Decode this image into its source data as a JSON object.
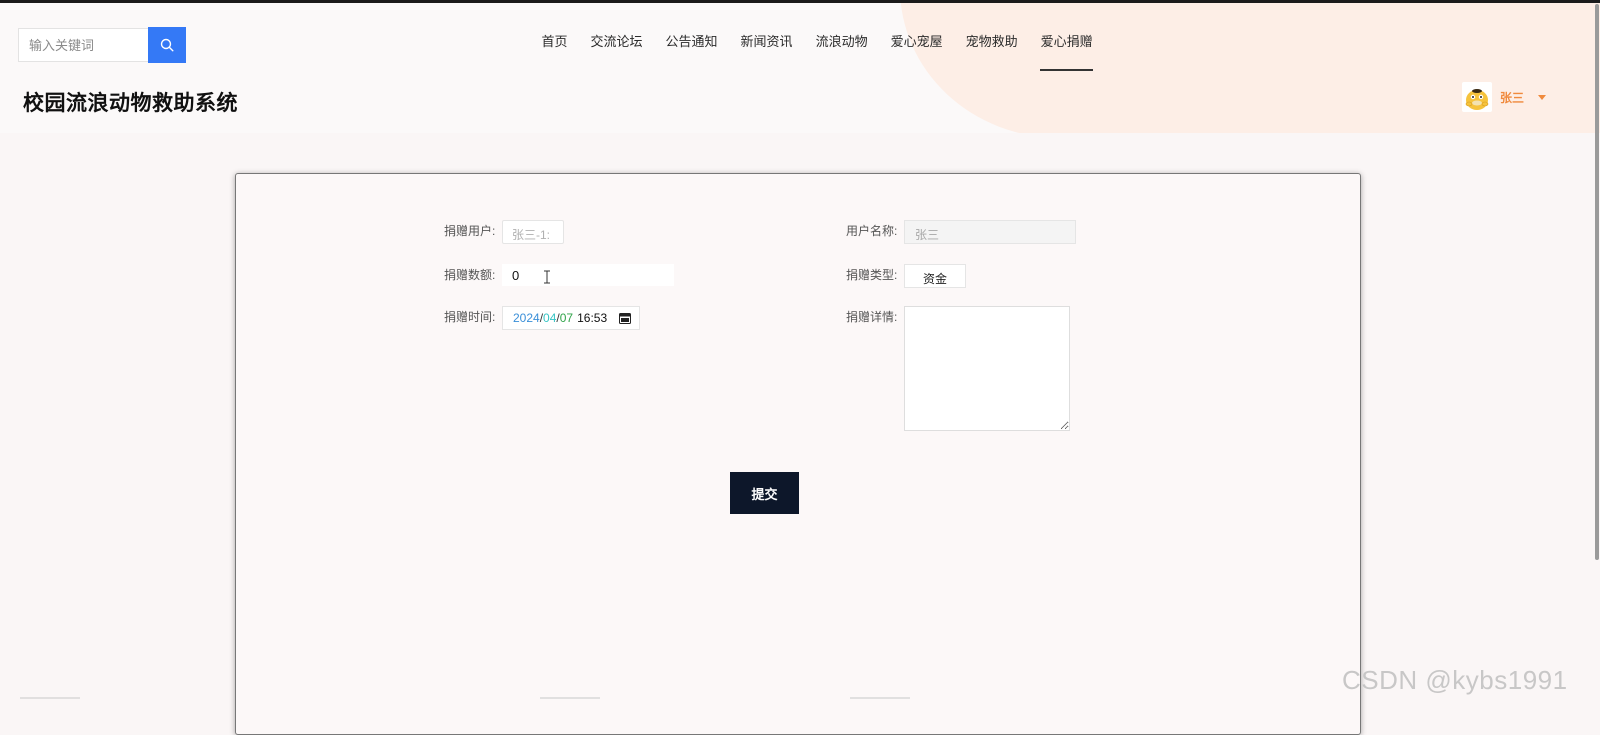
{
  "search": {
    "placeholder": "输入关键词",
    "icon": "search-icon"
  },
  "nav": {
    "items": [
      {
        "label": "首页",
        "active": false
      },
      {
        "label": "交流论坛",
        "active": false
      },
      {
        "label": "公告通知",
        "active": false
      },
      {
        "label": "新闻资讯",
        "active": false
      },
      {
        "label": "流浪动物",
        "active": false
      },
      {
        "label": "爱心宠屋",
        "active": false
      },
      {
        "label": "宠物救助",
        "active": false
      },
      {
        "label": "爱心捐赠",
        "active": true
      }
    ]
  },
  "header": {
    "title": "校园流浪动物救助系统"
  },
  "user": {
    "name": "张三",
    "avatar_icon": "duck-avatar-icon",
    "caret_icon": "caret-down-icon"
  },
  "form": {
    "donor_user": {
      "label": "捐赠用户:",
      "value": "张三-1:"
    },
    "amount": {
      "label": "捐赠数额:",
      "value": "0"
    },
    "time": {
      "label": "捐赠时间:",
      "year": "2024",
      "month": "04",
      "day": "07",
      "sep": "/",
      "clock": "16:53"
    },
    "username": {
      "label": "用户名称:",
      "value": "张三"
    },
    "type": {
      "label": "捐赠类型:",
      "value": "资金"
    },
    "detail": {
      "label": "捐赠详情:",
      "value": ""
    },
    "submit_label": "提交"
  },
  "watermark": "CSDN @kybs1991",
  "colors": {
    "accent_blue": "#3479f6",
    "submit_bg": "#0d172a",
    "user_orange": "#f08a3d",
    "header_peach": "#fdeee6"
  }
}
